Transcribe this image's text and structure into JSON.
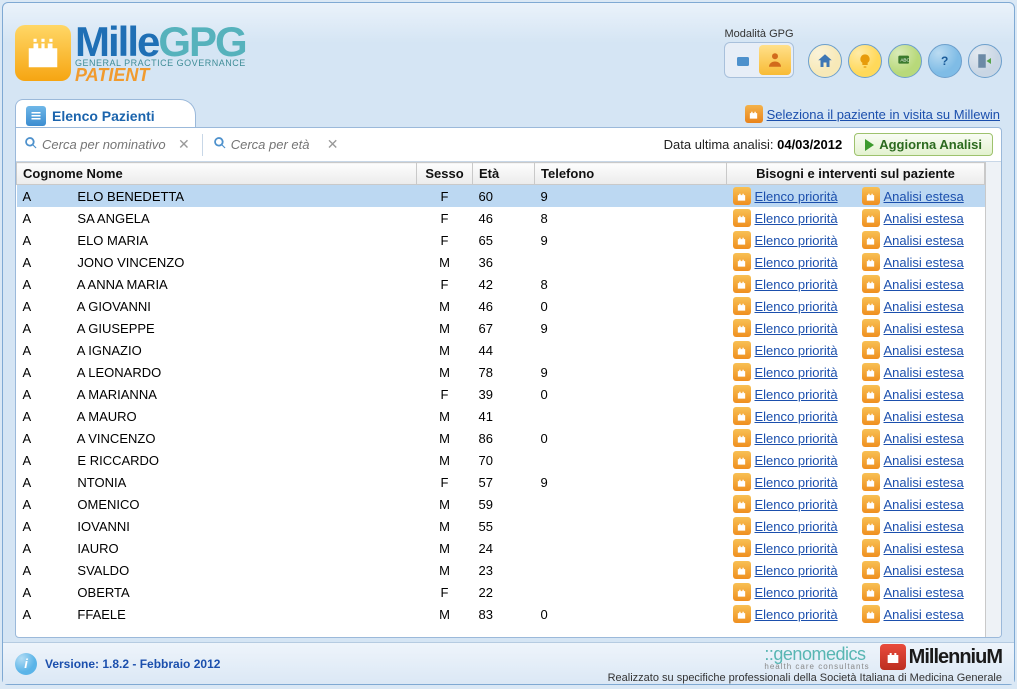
{
  "header": {
    "app_name_part1": "Mille",
    "app_name_part2": "GPG",
    "subtitle1": "GENERAL PRACTICE GOVERNANCE",
    "subtitle2": "PATIENT",
    "modality_label": "Modalità GPG"
  },
  "tab": {
    "title": "Elenco Pazienti"
  },
  "millewin_link": "Seleziona il paziente in visita su Millewin",
  "filters": {
    "name_placeholder": "Cerca per nominativo",
    "age_placeholder": "Cerca per età"
  },
  "analysis": {
    "label": "Data ultima analisi:",
    "date": "04/03/2012",
    "refresh_label": "Aggiorna Analisi"
  },
  "columns": {
    "name": "Cognome Nome",
    "sex": "Sesso",
    "age": "Età",
    "tel": "Telefono",
    "needs": "Bisogni e interventi sul paziente"
  },
  "action_labels": {
    "priorities": "Elenco priorità",
    "extended": "Analisi estesa"
  },
  "patients": [
    {
      "name": "A             ELO BENEDETTA",
      "sex": "F",
      "age": "60",
      "tel": "9"
    },
    {
      "name": "A             SA ANGELA",
      "sex": "F",
      "age": "46",
      "tel": "8"
    },
    {
      "name": "A             ELO MARIA",
      "sex": "F",
      "age": "65",
      "tel": "9"
    },
    {
      "name": "A             JONO VINCENZO",
      "sex": "M",
      "age": "36",
      "tel": ""
    },
    {
      "name": "A             A ANNA MARIA",
      "sex": "F",
      "age": "42",
      "tel": "8"
    },
    {
      "name": "A             A GIOVANNI",
      "sex": "M",
      "age": "46",
      "tel": "0"
    },
    {
      "name": "A             A GIUSEPPE",
      "sex": "M",
      "age": "67",
      "tel": "9"
    },
    {
      "name": "A             A IGNAZIO",
      "sex": "M",
      "age": "44",
      "tel": ""
    },
    {
      "name": "A             A LEONARDO",
      "sex": "M",
      "age": "78",
      "tel": "9"
    },
    {
      "name": "A             A MARIANNA",
      "sex": "F",
      "age": "39",
      "tel": "0"
    },
    {
      "name": "A             A MAURO",
      "sex": "M",
      "age": "41",
      "tel": ""
    },
    {
      "name": "A             A VINCENZO",
      "sex": "M",
      "age": "86",
      "tel": "0"
    },
    {
      "name": "A             E RICCARDO",
      "sex": "M",
      "age": "70",
      "tel": ""
    },
    {
      "name": "A             NTONIA",
      "sex": "F",
      "age": "57",
      "tel": "9"
    },
    {
      "name": "A             OMENICO",
      "sex": "M",
      "age": "59",
      "tel": ""
    },
    {
      "name": "A             IOVANNI",
      "sex": "M",
      "age": "55",
      "tel": ""
    },
    {
      "name": "A             IAURO",
      "sex": "M",
      "age": "24",
      "tel": ""
    },
    {
      "name": "A             SVALDO",
      "sex": "M",
      "age": "23",
      "tel": ""
    },
    {
      "name": "A             OBERTA",
      "sex": "F",
      "age": "22",
      "tel": ""
    },
    {
      "name": "A             FFAELE",
      "sex": "M",
      "age": "83",
      "tel": "0"
    }
  ],
  "footer": {
    "version": "Versione: 1.8.2 - Febbraio 2012",
    "genomedics": "genomedics",
    "genomedics_sub": "health care consultants",
    "millennium": "MillenniuM",
    "credits": "Realizzato su specifiche professionali della Società Italiana di Medicina Generale"
  }
}
